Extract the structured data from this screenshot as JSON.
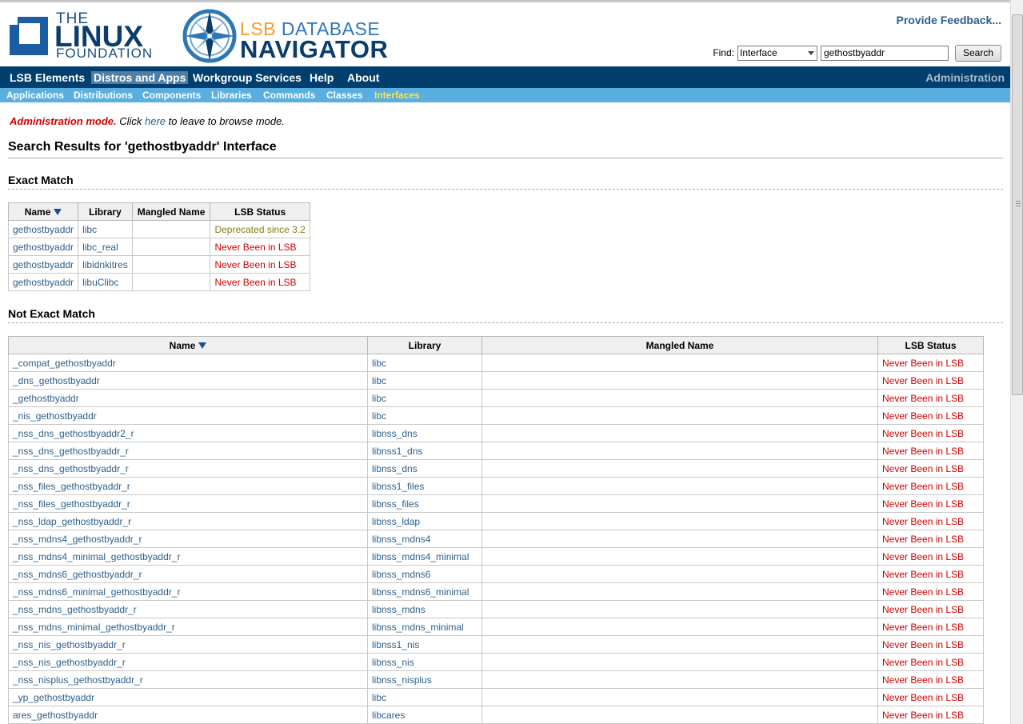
{
  "header": {
    "logo_the": "THE",
    "logo_linux": "LINUX",
    "logo_foundation": "FOUNDATION",
    "logo_lsb": "LSB",
    "logo_database": " DATABASE",
    "logo_navigator": "NAVIGATOR",
    "feedback": "Provide Feedback...",
    "find_label": "Find:",
    "find_select": "Interface",
    "find_value": "gethostbyaddr",
    "search_button": "Search"
  },
  "mainnav": {
    "items": [
      "LSB Elements",
      "Distros and Apps",
      "Workgroup Services",
      "Help",
      "About"
    ],
    "active": "Distros and Apps",
    "admin": "Administration"
  },
  "subnav": {
    "items": [
      "Applications",
      "Distributions",
      "Components",
      "Libraries",
      "Commands",
      "Classes",
      "Interfaces"
    ],
    "active": "Interfaces"
  },
  "content": {
    "admin_mode": "Administration mode.",
    "admin_click": " Click ",
    "admin_here": "here",
    "admin_rest": " to leave to browse mode.",
    "page_title": "Search Results for 'gethostbyaddr' Interface",
    "exact_title": "Exact Match",
    "not_exact_title": "Not Exact Match",
    "columns": [
      "Name",
      "Library",
      "Mangled Name",
      "LSB Status"
    ]
  },
  "exact_rows": [
    {
      "name": "gethostbyaddr",
      "library": "libc",
      "mangled": "",
      "status": "Deprecated since 3.2"
    },
    {
      "name": "gethostbyaddr",
      "library": "libc_real",
      "mangled": "",
      "status": "Never Been in LSB"
    },
    {
      "name": "gethostbyaddr",
      "library": "libidnkitres",
      "mangled": "",
      "status": "Never Been in LSB"
    },
    {
      "name": "gethostbyaddr",
      "library": "libuClibc",
      "mangled": "",
      "status": "Never Been in LSB"
    }
  ],
  "not_exact_rows": [
    {
      "name": "_compat_gethostbyaddr",
      "library": "libc",
      "mangled": "",
      "status": "Never Been in LSB"
    },
    {
      "name": "_dns_gethostbyaddr",
      "library": "libc",
      "mangled": "",
      "status": "Never Been in LSB"
    },
    {
      "name": "_gethostbyaddr",
      "library": "libc",
      "mangled": "",
      "status": "Never Been in LSB"
    },
    {
      "name": "_nis_gethostbyaddr",
      "library": "libc",
      "mangled": "",
      "status": "Never Been in LSB"
    },
    {
      "name": "_nss_dns_gethostbyaddr2_r",
      "library": "libnss_dns",
      "mangled": "",
      "status": "Never Been in LSB"
    },
    {
      "name": "_nss_dns_gethostbyaddr_r",
      "library": "libnss1_dns",
      "mangled": "",
      "status": "Never Been in LSB"
    },
    {
      "name": "_nss_dns_gethostbyaddr_r",
      "library": "libnss_dns",
      "mangled": "",
      "status": "Never Been in LSB"
    },
    {
      "name": "_nss_files_gethostbyaddr_r",
      "library": "libnss1_files",
      "mangled": "",
      "status": "Never Been in LSB"
    },
    {
      "name": "_nss_files_gethostbyaddr_r",
      "library": "libnss_files",
      "mangled": "",
      "status": "Never Been in LSB"
    },
    {
      "name": "_nss_ldap_gethostbyaddr_r",
      "library": "libnss_ldap",
      "mangled": "",
      "status": "Never Been in LSB"
    },
    {
      "name": "_nss_mdns4_gethostbyaddr_r",
      "library": "libnss_mdns4",
      "mangled": "",
      "status": "Never Been in LSB"
    },
    {
      "name": "_nss_mdns4_minimal_gethostbyaddr_r",
      "library": "libnss_mdns4_minimal",
      "mangled": "",
      "status": "Never Been in LSB"
    },
    {
      "name": "_nss_mdns6_gethostbyaddr_r",
      "library": "libnss_mdns6",
      "mangled": "",
      "status": "Never Been in LSB"
    },
    {
      "name": "_nss_mdns6_minimal_gethostbyaddr_r",
      "library": "libnss_mdns6_minimal",
      "mangled": "",
      "status": "Never Been in LSB"
    },
    {
      "name": "_nss_mdns_gethostbyaddr_r",
      "library": "libnss_mdns",
      "mangled": "",
      "status": "Never Been in LSB"
    },
    {
      "name": "_nss_mdns_minimal_gethostbyaddr_r",
      "library": "libnss_mdns_minimal",
      "mangled": "",
      "status": "Never Been in LSB"
    },
    {
      "name": "_nss_nis_gethostbyaddr_r",
      "library": "libnss1_nis",
      "mangled": "",
      "status": "Never Been in LSB"
    },
    {
      "name": "_nss_nis_gethostbyaddr_r",
      "library": "libnss_nis",
      "mangled": "",
      "status": "Never Been in LSB"
    },
    {
      "name": "_nss_nisplus_gethostbyaddr_r",
      "library": "libnss_nisplus",
      "mangled": "",
      "status": "Never Been in LSB"
    },
    {
      "name": "_yp_gethostbyaddr",
      "library": "libc",
      "mangled": "",
      "status": "Never Been in LSB"
    },
    {
      "name": "ares_gethostbyaddr",
      "library": "libcares",
      "mangled": "",
      "status": "Never Been in LSB"
    }
  ],
  "colors": {
    "nav_bg": "#003f6e",
    "subnav_bg": "#5aaee0",
    "link": "#2d5f8a",
    "status_never": "#d10000",
    "status_deprecated": "#8a7a10",
    "subnav_active": "#ffe34a"
  }
}
